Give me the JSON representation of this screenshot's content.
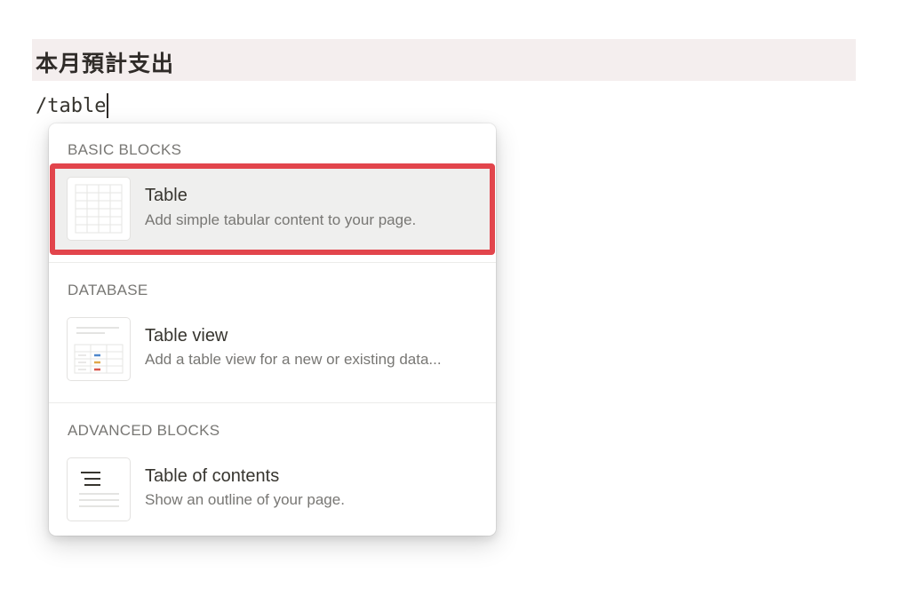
{
  "page": {
    "heading": "本月預計支出",
    "command_text": "/table"
  },
  "menu": {
    "sections": [
      {
        "label": "BASIC BLOCKS",
        "items": [
          {
            "title": "Table",
            "description": "Add simple tabular content to your page.",
            "icon": "table-icon",
            "highlighted": true
          }
        ]
      },
      {
        "label": "DATABASE",
        "items": [
          {
            "title": "Table view",
            "description": "Add a table view for a new or existing data...",
            "icon": "table-view-icon"
          }
        ]
      },
      {
        "label": "ADVANCED BLOCKS",
        "items": [
          {
            "title": "Table of contents",
            "description": "Show an outline of your page.",
            "icon": "table-of-contents-icon"
          }
        ]
      }
    ]
  },
  "colors": {
    "highlight_border": "#e2454c",
    "heading_background": "#f4eeee",
    "hover_background": "#efefee"
  }
}
